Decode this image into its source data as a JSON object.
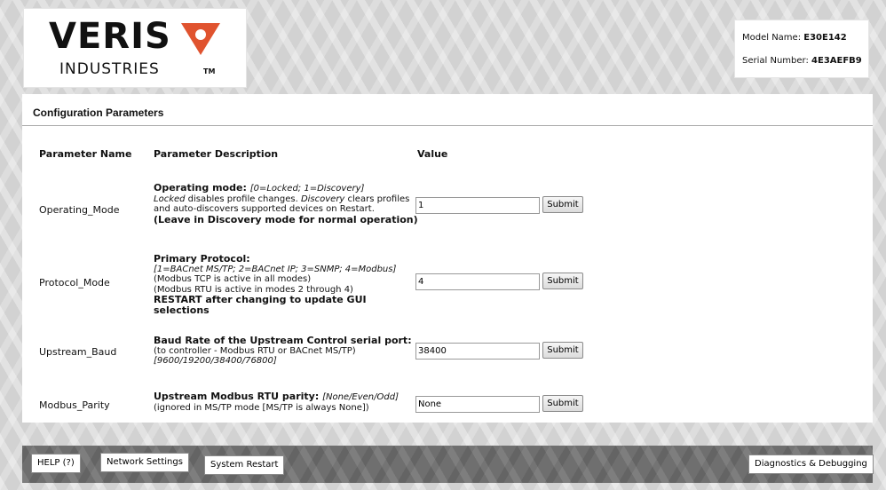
{
  "brand": {
    "name": "VERIS",
    "sub": "INDUSTRIES",
    "tm": "TM",
    "accent": "#e0532f"
  },
  "device": {
    "model_label": "Model Name: ",
    "model_value": "E30E142",
    "serial_label": "Serial Number: ",
    "serial_value": "4E3AEFB9"
  },
  "section_title": "Configuration Parameters",
  "columns": {
    "name": "Parameter Name",
    "description": "Parameter Description",
    "value": "Value"
  },
  "params": [
    {
      "name": "Operating_Mode",
      "title": "Operating mode: ",
      "options": "[0=Locked; 1=Discovery]",
      "lines": [
        {
          "em": "Locked",
          "text": " disables profile changes. "
        },
        {
          "em": "Discovery",
          "text": " clears profiles"
        },
        {
          "text": "and auto-discovers supported devices on Restart."
        }
      ],
      "note": "(Leave in Discovery mode for normal operation)",
      "value": "1",
      "submit": "Submit"
    },
    {
      "name": "Protocol_Mode",
      "title": "Primary Protocol:",
      "options": "[1=BACnet MS/TP; 2=BACnet IP; 3=SNMP; 4=Modbus]",
      "line1": "(Modbus TCP is active in all modes)",
      "line2": "(Modbus RTU is active in modes 2 through 4)",
      "note": "RESTART after changing to update GUI selections",
      "value": "4",
      "submit": "Submit"
    },
    {
      "name": "Upstream_Baud",
      "title": "Baud Rate of the Upstream Control serial port:",
      "line1": "(to controller - Modbus RTU or BACnet MS/TP)",
      "options": "[9600/19200/38400/76800]",
      "value": "38400",
      "submit": "Submit"
    },
    {
      "name": "Modbus_Parity",
      "title": "Upstream Modbus RTU parity: ",
      "options": "[None/Even/Odd]",
      "line1": "(ignored in MS/TP mode [MS/TP is always None])",
      "value": "None",
      "submit": "Submit"
    }
  ],
  "footer": {
    "help": "HELP (?)",
    "network": "Network Settings",
    "restart": "System Restart",
    "diagnostics": "Diagnostics & Debugging"
  }
}
